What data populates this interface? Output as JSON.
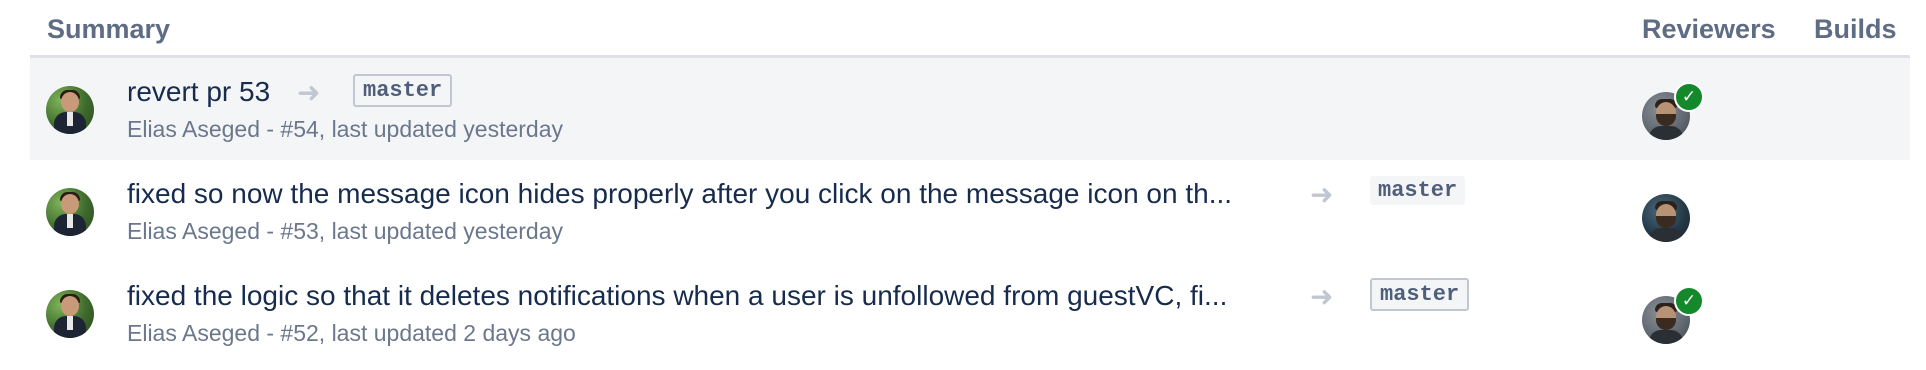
{
  "header": {
    "summary": "Summary",
    "reviewers": "Reviewers",
    "builds": "Builds"
  },
  "icons": {
    "arrow": "arrow-right-icon",
    "approved": "check-icon",
    "check_color": "#14892c"
  },
  "pull_requests": [
    {
      "title": "revert pr 53",
      "arrow": "➜",
      "branch": "master",
      "meta": "Elias Aseged - #54, last updated yesterday",
      "reviewer_approved": true,
      "check": "✓"
    },
    {
      "title": "fixed so now the message icon hides properly after you click on the message icon on th...",
      "arrow": "➜",
      "branch": "master",
      "meta": "Elias Aseged - #53, last updated yesterday",
      "reviewer_approved": false
    },
    {
      "title": "fixed the logic so that it deletes notifications when a user is unfollowed from guestVC, fi...",
      "arrow": "➜",
      "branch": "master",
      "meta": "Elias Aseged - #52, last updated 2 days ago",
      "reviewer_approved": true,
      "check": "✓"
    }
  ]
}
